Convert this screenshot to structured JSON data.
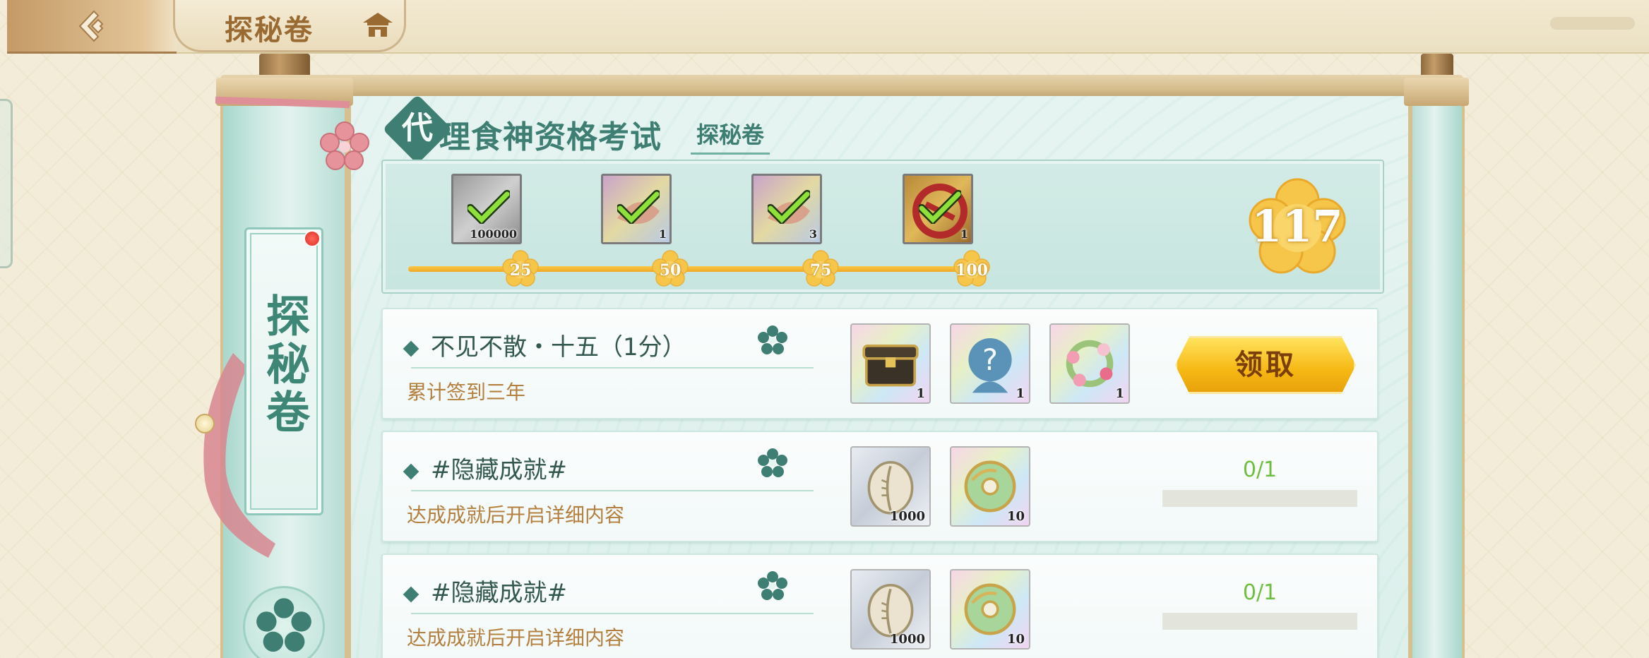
{
  "topbar": {
    "title": "探秘卷"
  },
  "sidebar": {
    "label": "探秘卷"
  },
  "header": {
    "badge_char": "代",
    "heading": "理食神资格考试",
    "subtab": "探秘卷"
  },
  "progress": {
    "score": "117",
    "fill_fraction": 0.965,
    "milestones": [
      {
        "points": "25",
        "reward_qty": "100000",
        "claimed": true,
        "reward_icon": "coin-icon"
      },
      {
        "points": "50",
        "reward_qty": "1",
        "claimed": true,
        "reward_icon": "talisman-icon"
      },
      {
        "points": "75",
        "reward_qty": "3",
        "claimed": true,
        "reward_icon": "talisman-icon"
      },
      {
        "points": "100",
        "reward_qty": "1",
        "claimed": true,
        "reward_icon": "red-charm-icon"
      }
    ]
  },
  "tasks": [
    {
      "title": "不见不散・十五（1分）",
      "description": "累计签到三年",
      "rewards": [
        {
          "icon": "treasure-chest-icon",
          "qty": "1"
        },
        {
          "icon": "mystery-avatar-icon",
          "qty": "1"
        },
        {
          "icon": "flower-wreath-icon",
          "qty": "1"
        }
      ],
      "claim_label": "领取"
    },
    {
      "title": "#隐藏成就#",
      "description": "达成成就后开启详细内容",
      "rewards": [
        {
          "icon": "shell-coin-icon",
          "qty": "1000"
        },
        {
          "icon": "jade-disc-icon",
          "qty": "10"
        }
      ],
      "progress_current": "0",
      "progress_total": "/1",
      "progress_fraction": 0
    },
    {
      "title": "#隐藏成就#",
      "description": "达成成就后开启详细内容",
      "rewards": [
        {
          "icon": "shell-coin-icon",
          "qty": "1000"
        },
        {
          "icon": "jade-disc-icon",
          "qty": "10"
        }
      ],
      "progress_current": "0",
      "progress_total": "/1",
      "progress_fraction": 0
    }
  ],
  "colors": {
    "accent_teal": "#3f7e73",
    "gold": "#f6b814",
    "progress_green": "#6fbf3f"
  }
}
